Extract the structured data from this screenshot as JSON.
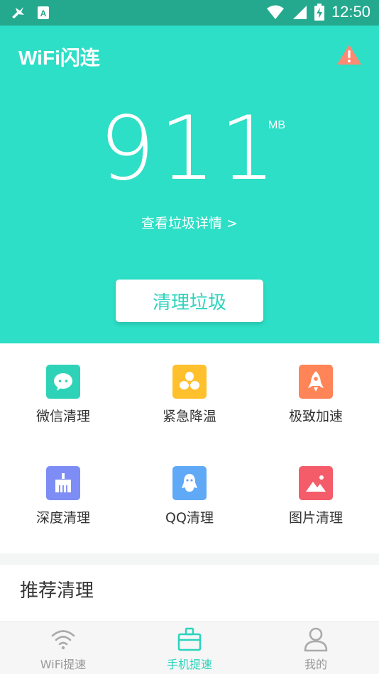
{
  "status_bar": {
    "time": "12:50",
    "icons": [
      "app-notification-icon",
      "font-a-icon",
      "wifi-icon",
      "cell-signal-icon",
      "battery-charging-icon"
    ]
  },
  "header": {
    "app_title": "WiFi闪连",
    "warning_icon": "warning-icon"
  },
  "hero": {
    "junk_size": "911",
    "junk_unit": "MB",
    "detail_link": "查看垃圾详情 >",
    "clean_button": "清理垃圾"
  },
  "tools": [
    {
      "label": "微信清理",
      "icon": "wechat-icon",
      "color": "#2ed3b7"
    },
    {
      "label": "紧急降温",
      "icon": "fan-icon",
      "color": "#ffc02e"
    },
    {
      "label": "极致加速",
      "icon": "rocket-icon",
      "color": "#ff8457"
    },
    {
      "label": "深度清理",
      "icon": "broom-icon",
      "color": "#7d8df5"
    },
    {
      "label": "QQ清理",
      "icon": "qq-icon",
      "color": "#5fa9f7"
    },
    {
      "label": "图片清理",
      "icon": "picture-icon",
      "color": "#f55c6a"
    }
  ],
  "recommend": {
    "title": "推荐清理"
  },
  "tabs": [
    {
      "label": "WiFi提速",
      "icon": "wifi-icon",
      "active": false
    },
    {
      "label": "手机提速",
      "icon": "toolbox-icon",
      "active": true
    },
    {
      "label": "我的",
      "icon": "user-icon",
      "active": false
    }
  ],
  "colors": {
    "primary": "#2cdfc6",
    "status_bar": "#24a98e",
    "accent_text": "#2ed3bd",
    "tab_inactive": "#999999"
  }
}
